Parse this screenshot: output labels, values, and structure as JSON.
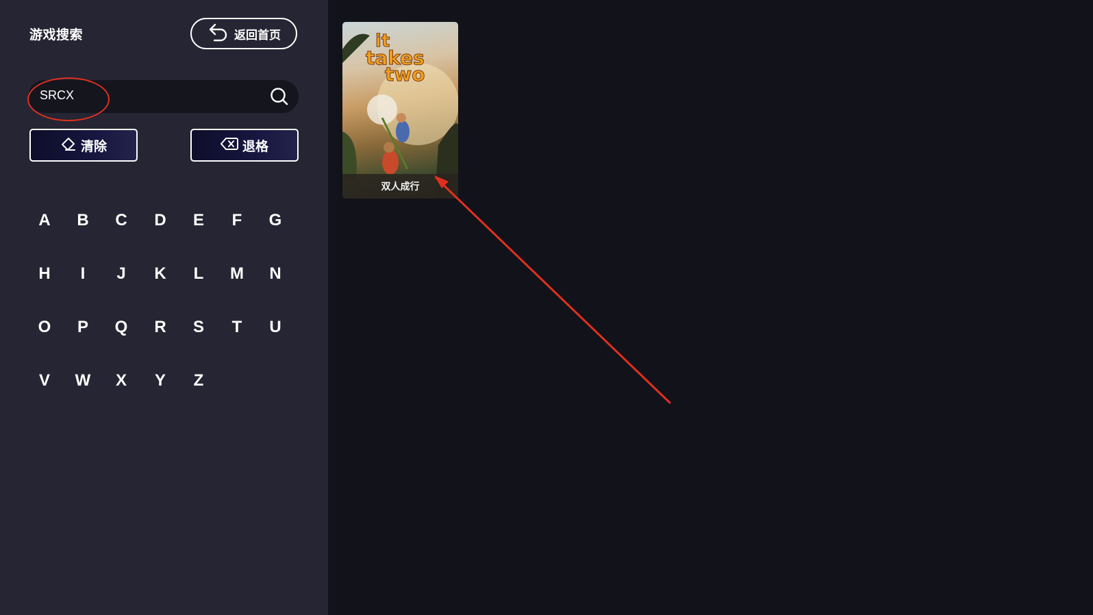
{
  "sidebar": {
    "title": "游戏搜索",
    "home_button_label": "返回首页",
    "search": {
      "value": "SRCX",
      "icon": "search-icon"
    },
    "clear_button_label": "清除",
    "backspace_button_label": "退格",
    "keyboard": [
      [
        "A",
        "B",
        "C",
        "D",
        "E",
        "F",
        "G"
      ],
      [
        "H",
        "I",
        "J",
        "K",
        "L",
        "M",
        "N"
      ],
      [
        "O",
        "P",
        "Q",
        "R",
        "S",
        "T",
        "U"
      ],
      [
        "V",
        "W",
        "X",
        "Y",
        "Z"
      ]
    ]
  },
  "results": [
    {
      "cover_logo": [
        "it",
        "takes",
        "two"
      ],
      "title": "双人成行"
    }
  ],
  "colors": {
    "sidebar_bg": "#252533",
    "content_bg": "#12121a",
    "annotation": "#e0301e",
    "logo": "#f0a020"
  }
}
